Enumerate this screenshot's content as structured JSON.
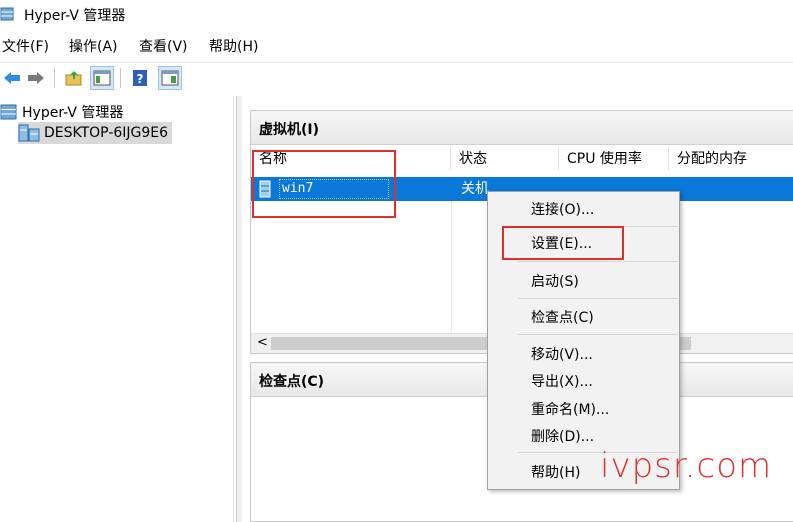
{
  "window": {
    "title": "Hyper-V 管理器"
  },
  "menu": [
    "文件(F)",
    "操作(A)",
    "查看(V)",
    "帮助(H)"
  ],
  "toolbar": {
    "icons": [
      "back-arrow-icon",
      "forward-arrow-icon",
      "up-folder-icon",
      "show-hide-pane-icon",
      "help-icon",
      "properties-pane-icon"
    ]
  },
  "tree": {
    "root": "Hyper-V 管理器",
    "server": "DESKTOP-6IJG9E6"
  },
  "vm_pane": {
    "title": "虚拟机(I)",
    "columns": [
      "名称",
      "状态",
      "CPU 使用率",
      "分配的内存"
    ],
    "rows": [
      {
        "name": "win7",
        "state": "关机"
      }
    ],
    "scroll_left": "<"
  },
  "checkpoint_pane": {
    "title": "检查点(C)"
  },
  "context_menu": {
    "items": [
      "连接(O)...",
      "设置(E)...",
      "启动(S)",
      "检查点(C)",
      "移动(V)...",
      "导出(X)...",
      "重命名(M)...",
      "删除(D)...",
      "帮助(H)"
    ]
  },
  "watermark": "ivpsr.com",
  "colors": {
    "selection": "#0a78d7",
    "annotation_red": "#e0302a"
  }
}
